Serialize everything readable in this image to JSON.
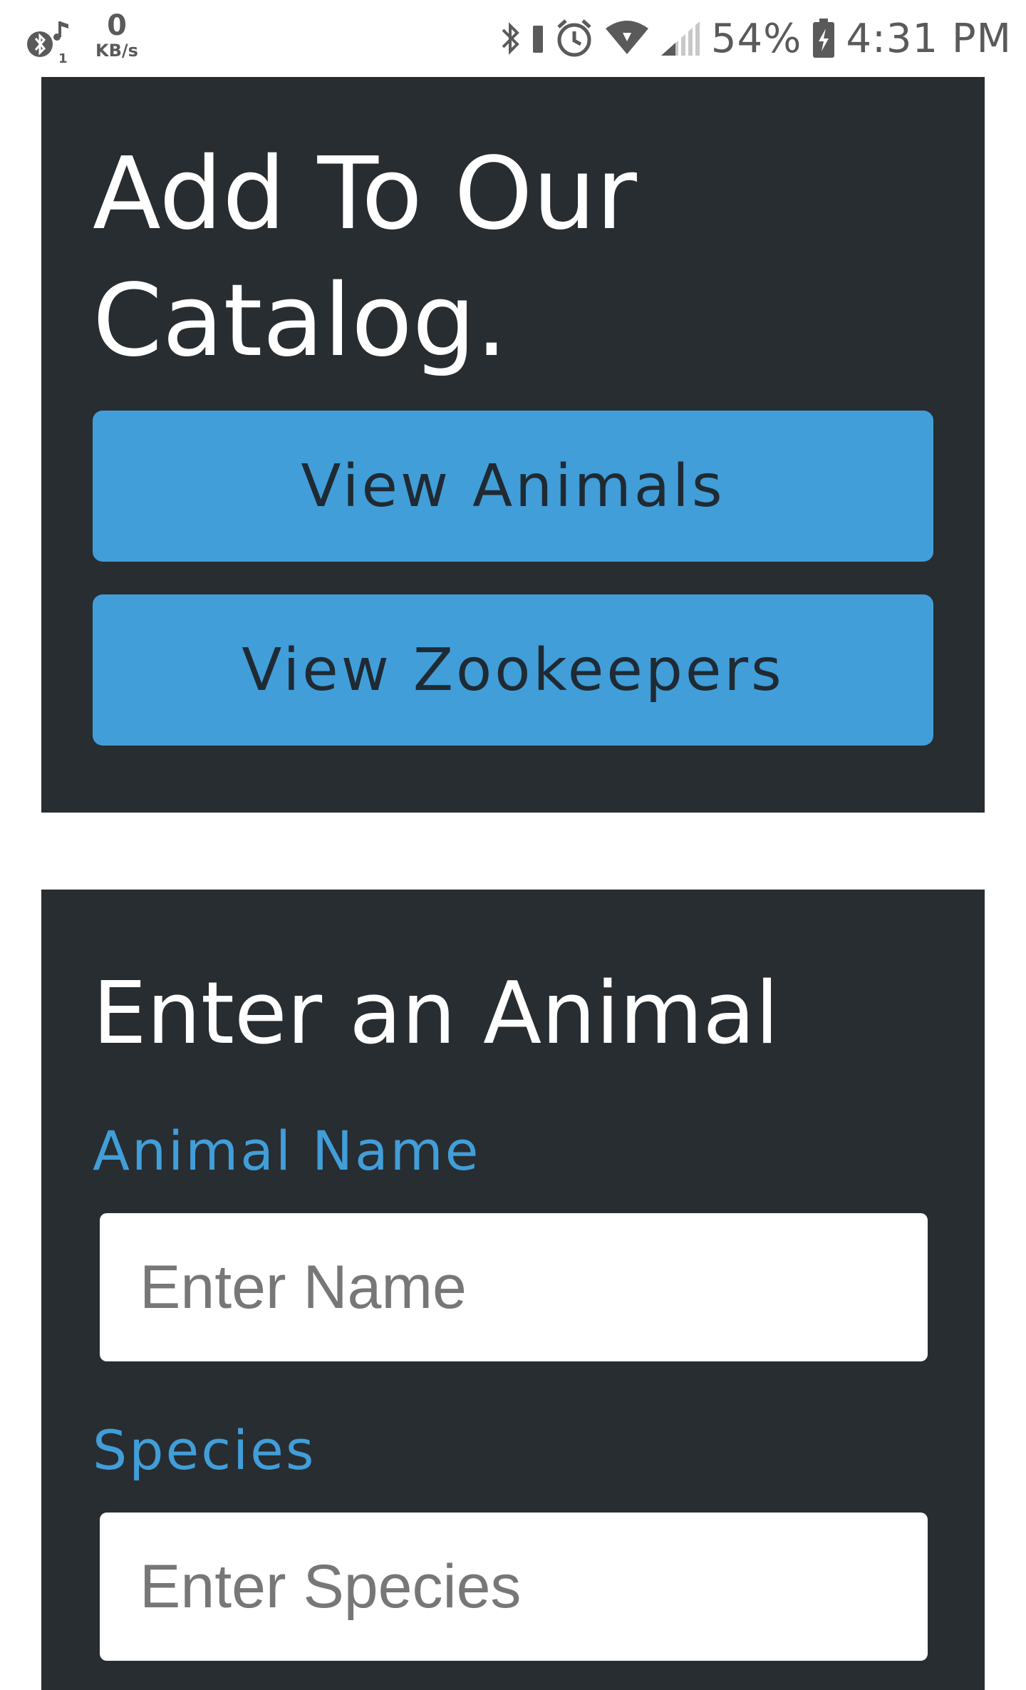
{
  "status_bar": {
    "network_speed_value": "0",
    "network_speed_unit": "KB/s",
    "battery_percent": "54%",
    "time": "4:31 PM",
    "icons": [
      "bluetooth-music-icon",
      "bluetooth-icon",
      "battery-saver-icon",
      "alarm-icon",
      "wifi-icon",
      "signal-icon",
      "battery-charging-icon"
    ]
  },
  "catalog_card": {
    "title": "Add To Our Catalog.",
    "view_animals_label": "View Animals",
    "view_zookeepers_label": "View Zookeepers"
  },
  "animal_form": {
    "title": "Enter an Animal",
    "name_label": "Animal Name",
    "name_placeholder": "Enter Name",
    "name_value": "",
    "species_label": "Species",
    "species_placeholder": "Enter Species",
    "species_value": ""
  },
  "colors": {
    "card_background": "#282d31",
    "accent_blue": "#419ed9",
    "button_text": "#1f2a33",
    "heading_text": "#ffffff",
    "placeholder_text": "#777777"
  }
}
